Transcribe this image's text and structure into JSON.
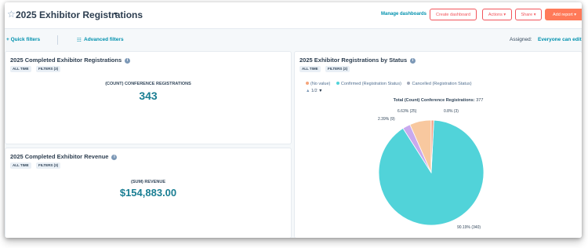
{
  "header": {
    "title": "2025 Exhibitor Registrations",
    "manage_dashboards": "Manage dashboards",
    "create_dashboard": "Create dashboard",
    "actions": "Actions ▾",
    "share": "Share ▾",
    "add_report": "Add report ▾"
  },
  "filters": {
    "quick_filters": "+ Quick filters",
    "advanced_filters": "Advanced filters",
    "assigned_label": "Assigned:",
    "assigned_value": "Everyone can edit"
  },
  "cards": [
    {
      "title": "2025 Completed Exhibitor Registrations",
      "tags": [
        "ALL TIME",
        "FILTERS (3)"
      ],
      "metric_label": "(COUNT) CONFERENCE REGISTRATIONS",
      "metric_value": "343"
    },
    {
      "title": "2025 Completed Exhibitor Revenue",
      "tags": [
        "ALL TIME",
        "FILTERS (3)"
      ],
      "metric_label": "(SUM) REVENUE",
      "metric_value": "$154,883.00"
    },
    {
      "title": "2025 Exhibitor Registrations by Status",
      "tags": [
        "ALL TIME",
        "FILTERS (2)"
      ],
      "legend": [
        {
          "label": "(No value)",
          "color": "#f5a57b"
        },
        {
          "label": "Confirmed (Registration Status)",
          "color": "#51d3d9"
        },
        {
          "label": "Cancelled (Registration Status)",
          "color": "#a2a8b8"
        }
      ],
      "pager": "1/2",
      "total_label": "Total (Count) Conference Registrations:",
      "total_value": "377"
    }
  ],
  "chart_data": {
    "type": "pie",
    "total": 377,
    "slices": [
      {
        "label": "90.19% (340)",
        "value": 340,
        "percent": 90.19,
        "color": "#51d3d9"
      },
      {
        "label": "2.39% (9)",
        "value": 9,
        "percent": 2.39,
        "color": "#c8a9ee"
      },
      {
        "label": "6.63% (25)",
        "value": 25,
        "percent": 6.63,
        "color": "#f8c89f"
      },
      {
        "label": "0.8% (3)",
        "value": 3,
        "percent": 0.8,
        "color": "#f2a48a"
      }
    ]
  }
}
